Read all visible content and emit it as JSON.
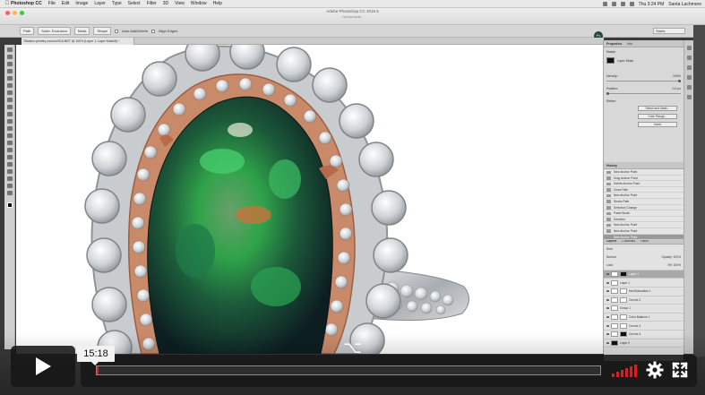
{
  "menubar": {
    "items": [
      "Photoshop CC",
      "File",
      "Edit",
      "Image",
      "Layer",
      "Type",
      "Select",
      "Filter",
      "3D",
      "View",
      "Window",
      "Help"
    ],
    "clock": "Thu 3:24 PM",
    "user": "Santa Lachmore"
  },
  "window": {
    "title": "Adobe Photoshop CC 2015.5",
    "subtitle": "~/photos/opal/..."
  },
  "options": {
    "mode": "Path",
    "segment1": "Subtr. Exclusion",
    "segment2": "Mask",
    "segment3": "Shape",
    "auto_label": "Auto Add/Delete",
    "align_label": "Align Edges",
    "workspace": "Starts",
    "badge": "Ps"
  },
  "document": {
    "tab": "Titanium-jewelry-course2016.NEF @ 100% (Layer 1, Layer Mask/8) *"
  },
  "properties": {
    "tabs": [
      "Properties",
      "Info"
    ],
    "header": "Masks",
    "mask_label": "Layer Mask",
    "density_label": "Density:",
    "density_value": "100%",
    "feather_label": "Feather:",
    "feather_value": "0.0 px",
    "refine_label": "Refine:",
    "btn_select_mask": "Select and Mask...",
    "btn_color_range": "Color Range...",
    "btn_invert": "Invert"
  },
  "history": {
    "title": "History",
    "items": [
      "New Anchor Point",
      "Drag Anchor Point",
      "Delete Anchor Point",
      "Close Path",
      "New Anchor Point",
      "Stroke Path",
      "Selection Change",
      "Paste Brush",
      "Deselect",
      "New Anchor Point",
      "New Anchor Point",
      "New Anchor Point"
    ]
  },
  "layers": {
    "tabs": [
      "Layers",
      "Channels",
      "Paths"
    ],
    "kind_label": "Kind",
    "blend": "Normal",
    "opacity_label": "Opacity:",
    "opacity_value": "100%",
    "lock_label": "Lock:",
    "fill_label": "Fill:",
    "fill_value": "100%",
    "items": [
      "Layer 1",
      "Layer 1",
      "Hue/Saturation 1",
      "Curves 2",
      "Group 1",
      "Color Balance 1",
      "Curves 3",
      "Curves 4",
      "Layer 0"
    ]
  },
  "player": {
    "time": "15:18",
    "progress": 0.0035
  },
  "colors": {
    "accent": "#d81f1f"
  }
}
